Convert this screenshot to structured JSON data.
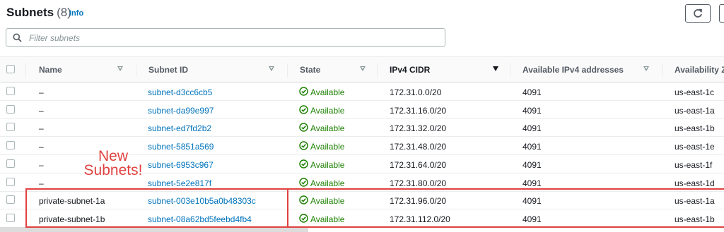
{
  "header": {
    "title": "Subnets",
    "count": "(8)",
    "info_label": "Info"
  },
  "filter": {
    "placeholder": "Filter subnets",
    "value": ""
  },
  "columns": {
    "name": "Name",
    "subnet_id": "Subnet ID",
    "state": "State",
    "cidr": "IPv4 CIDR",
    "available_ips": "Available IPv4 addresses",
    "az": "Availability Z"
  },
  "rows": [
    {
      "name": "–",
      "subnet_id": "subnet-d3cc6cb5",
      "state": "Available",
      "cidr": "172.31.0.0/20",
      "available_ips": "4091",
      "az": "us-east-1c"
    },
    {
      "name": "–",
      "subnet_id": "subnet-da99e997",
      "state": "Available",
      "cidr": "172.31.16.0/20",
      "available_ips": "4091",
      "az": "us-east-1a"
    },
    {
      "name": "–",
      "subnet_id": "subnet-ed7fd2b2",
      "state": "Available",
      "cidr": "172.31.32.0/20",
      "available_ips": "4091",
      "az": "us-east-1b"
    },
    {
      "name": "–",
      "subnet_id": "subnet-5851a569",
      "state": "Available",
      "cidr": "172.31.48.0/20",
      "available_ips": "4091",
      "az": "us-east-1e"
    },
    {
      "name": "–",
      "subnet_id": "subnet-6953c967",
      "state": "Available",
      "cidr": "172.31.64.0/20",
      "available_ips": "4091",
      "az": "us-east-1f"
    },
    {
      "name": "–",
      "subnet_id": "subnet-5e2e817f",
      "state": "Available",
      "cidr": "172.31.80.0/20",
      "available_ips": "4091",
      "az": "us-east-1d"
    },
    {
      "name": "private-subnet-1a",
      "subnet_id": "subnet-003e10b5a0b48303c",
      "state": "Available",
      "cidr": "172.31.96.0/20",
      "available_ips": "4091",
      "az": "us-east-1a"
    },
    {
      "name": "private-subnet-1b",
      "subnet_id": "subnet-08a62bd5feebd4fb4",
      "state": "Available",
      "cidr": "172.31.112.0/20",
      "available_ips": "4091",
      "az": "us-east-1b"
    }
  ],
  "annotation": {
    "line1": "New",
    "line2": "Subnets!"
  },
  "icons": {
    "refresh": "refresh-icon",
    "search": "search-icon",
    "state_ok": "check-circle-icon",
    "sort": "sort-caret-icon"
  },
  "colors": {
    "link": "#0073bb",
    "available": "#1d8102",
    "annotation": "#e0413f"
  }
}
